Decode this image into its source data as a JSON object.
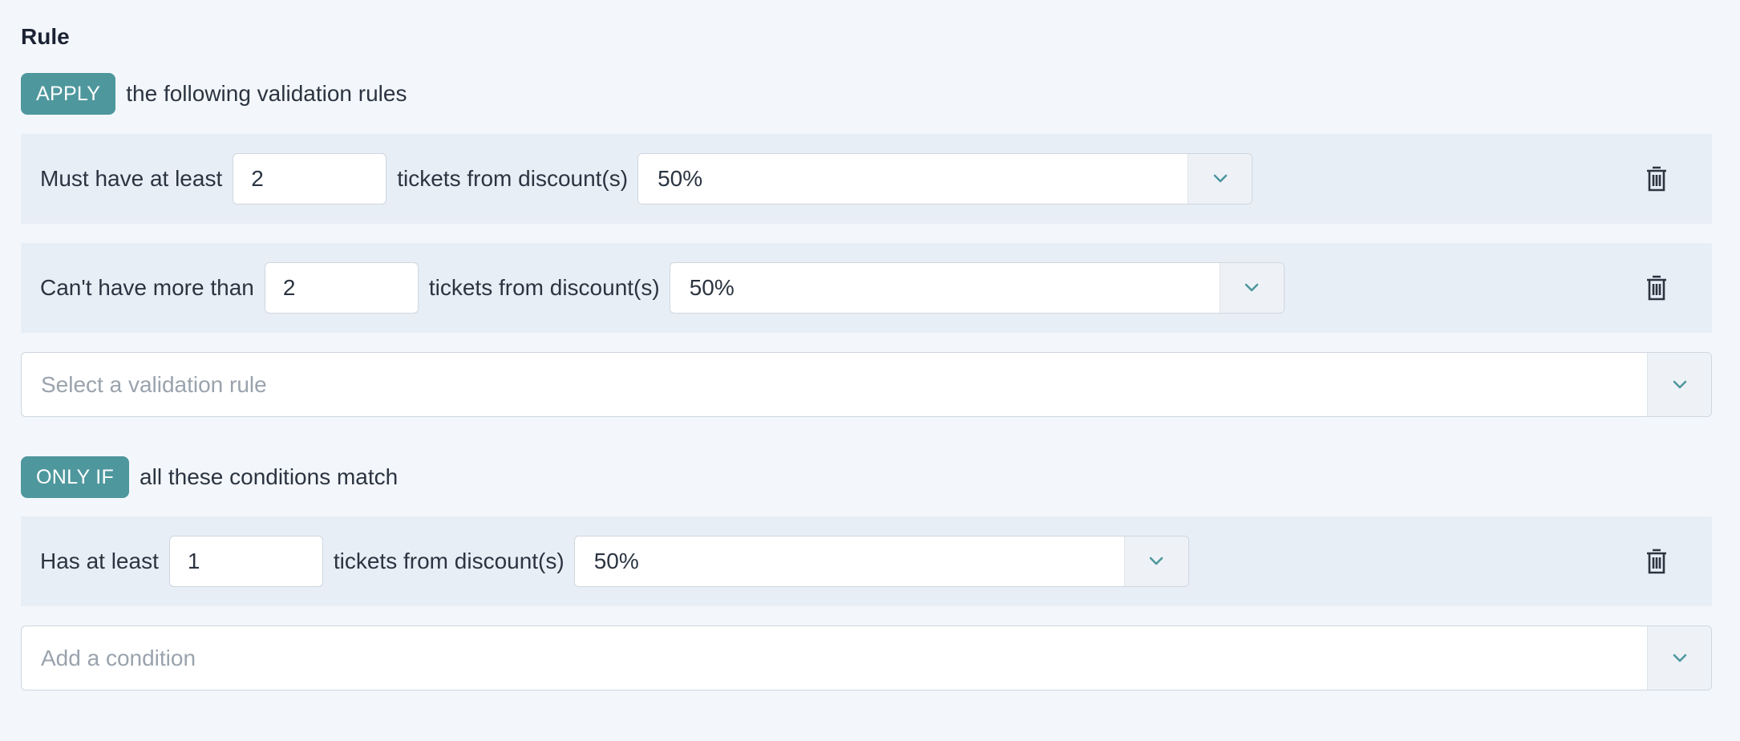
{
  "title": "Rule",
  "apply_section": {
    "pill": "APPLY",
    "text": "the following validation rules",
    "rules": [
      {
        "label": "Must have at least",
        "quantity": "2",
        "mid_label": "tickets from discount(s)",
        "discount": "50%"
      },
      {
        "label": "Can't have more than",
        "quantity": "2",
        "mid_label": "tickets from discount(s)",
        "discount": "50%"
      }
    ],
    "add_placeholder": "Select a validation rule"
  },
  "condition_section": {
    "pill": "ONLY IF",
    "text": "all these conditions match",
    "conditions": [
      {
        "label": "Has at least",
        "quantity": "1",
        "mid_label": "tickets from discount(s)",
        "discount": "50%"
      }
    ],
    "add_placeholder": "Add a condition"
  },
  "icons": {
    "dropdown": "chevron-down-icon",
    "delete": "trash-icon"
  },
  "colors": {
    "accent": "#4e979d",
    "background": "#f3f7fb",
    "row_background": "#e8eef6",
    "placeholder": "#9aa3ad"
  }
}
